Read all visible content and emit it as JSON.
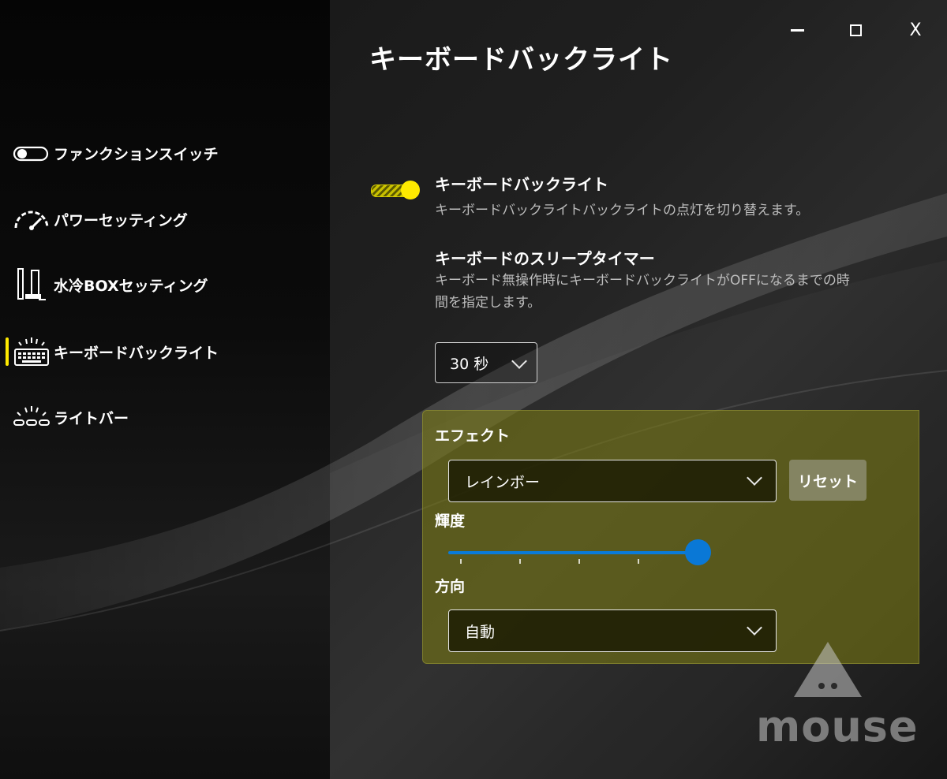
{
  "window": {
    "title": "キーボードバックライト",
    "controls": {
      "minimize": "—",
      "maximize": "□",
      "close": "X"
    }
  },
  "sidebar": {
    "items": [
      {
        "label": "ファンクションスイッチ",
        "icon": "toggle-switch-icon",
        "selected": false
      },
      {
        "label": "パワーセッティング",
        "icon": "speedometer-icon",
        "selected": false
      },
      {
        "label": "水冷BOXセッティング",
        "icon": "water-cooling-box-icon",
        "selected": false
      },
      {
        "label": "キーボードバックライト",
        "icon": "keyboard-backlight-icon",
        "selected": true
      },
      {
        "label": "ライトバー",
        "icon": "light-bar-icon",
        "selected": false
      }
    ],
    "selected_indicator_color": "#ffea00"
  },
  "backlight": {
    "title": "キーボードバックライト",
    "description": "キーボードバックライトバックライトの点灯を切り替えます。",
    "enabled": true,
    "toggle_color": "#ffea00"
  },
  "sleep_timer": {
    "title": "キーボードのスリープタイマー",
    "description_line1": "キーボード無操作時にキーボードバックライトがOFFになるまでの時",
    "description_line2": "間を指定します。",
    "value": "30 秒"
  },
  "effect_panel": {
    "effect_label": "エフェクト",
    "effect_value": "レインボー",
    "reset_label": "リセット",
    "brightness_label": "輝度",
    "brightness_value": 1.0,
    "direction_label": "方向",
    "direction_value": "自動",
    "panel_color": "#6f6f14",
    "slider_color": "#0a78d6"
  },
  "brand": {
    "logo_text": "mouse"
  }
}
